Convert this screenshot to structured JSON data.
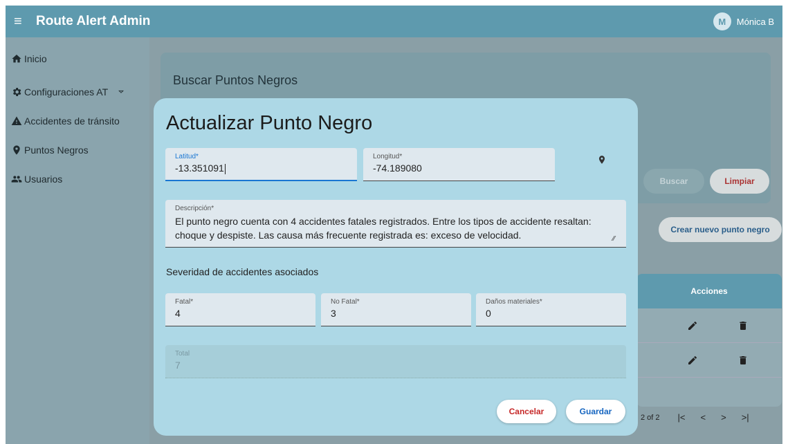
{
  "appbar": {
    "menu_icon": "menu-icon",
    "title": "Route Alert Admin",
    "avatar_initial": "M",
    "user_name": "Mónica B"
  },
  "sidebar": {
    "items": [
      {
        "label": "Inicio",
        "icon": "home-icon"
      },
      {
        "label": "Configuraciones AT",
        "icon": "gear-icon"
      },
      {
        "label": "Accidentes de tránsito",
        "icon": "warning-icon"
      },
      {
        "label": "Puntos Negros",
        "icon": "location-pin-icon"
      },
      {
        "label": "Usuarios",
        "icon": "users-icon"
      }
    ]
  },
  "background": {
    "search_title": "Buscar Puntos Negros",
    "buscar_label": "Buscar",
    "limpiar_label": "Limpiar",
    "crear_label": "Crear nuevo punto negro",
    "table_header": "Acciones",
    "pager_text": "2 of 2",
    "pager_first": "|<",
    "pager_prev": "<",
    "pager_next": ">",
    "pager_last": ">|"
  },
  "modal": {
    "title": "Actualizar Punto Negro",
    "latitud": {
      "label": "Latitud*",
      "value": "-13.351091"
    },
    "longitud": {
      "label": "Longitud*",
      "value": "-74.189080"
    },
    "descripcion": {
      "label": "Descripción*",
      "value": "El punto negro cuenta con 4 accidentes fatales registrados. Entre los tipos de accidente resaltan: choque y despiste. Las causa más frecuente registrada es: exceso de velocidad."
    },
    "severity_heading": "Severidad de accidentes asociados",
    "fatal": {
      "label": "Fatal*",
      "value": "4"
    },
    "no_fatal": {
      "label": "No Fatal*",
      "value": "3"
    },
    "danos": {
      "label": "Daños materiales*",
      "value": "0"
    },
    "total": {
      "label": "Total",
      "value": "7"
    },
    "cancel_label": "Cancelar",
    "save_label": "Guardar"
  }
}
